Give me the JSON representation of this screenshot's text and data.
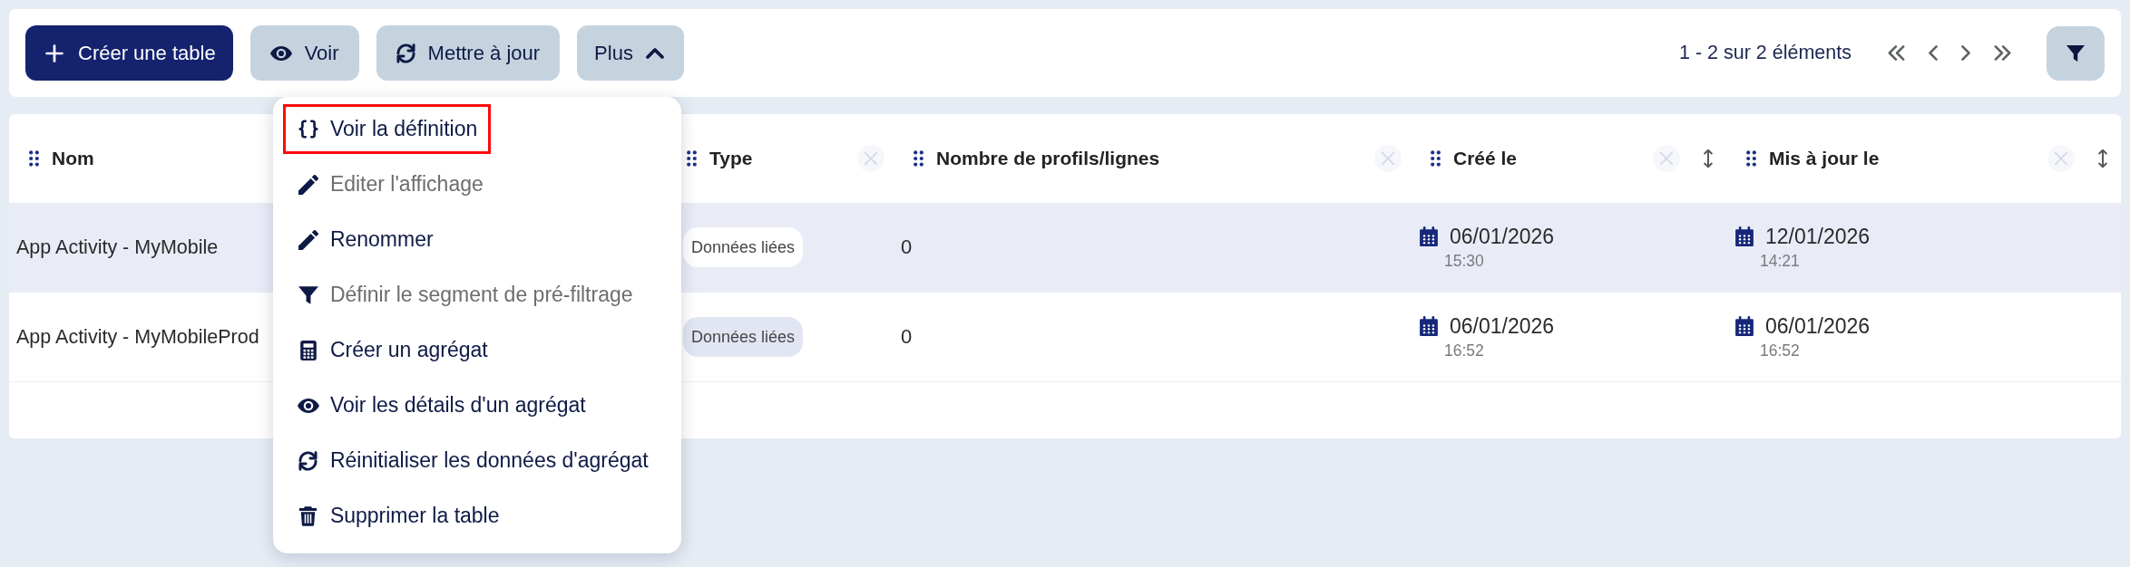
{
  "toolbar": {
    "buttons": [
      {
        "kind": "add",
        "label": "Créer une table"
      },
      {
        "kind": "view",
        "label": "Voir"
      },
      {
        "kind": "refresh",
        "label": "Mettre à jour"
      }
    ],
    "more_button": {
      "label": "Plus",
      "expanded": true
    },
    "pagination": {
      "summary": "1 - 2 sur 2 éléments"
    }
  },
  "menu": {
    "items": [
      {
        "kind": "code",
        "label": "Voir la définition",
        "disabled": false,
        "highlighted": true
      },
      {
        "kind": "edit",
        "label": "Editer l'affichage",
        "disabled": true,
        "highlighted": false
      },
      {
        "kind": "edit",
        "label": "Renommer",
        "disabled": false,
        "highlighted": false
      },
      {
        "kind": "filter",
        "label": "Définir le segment de pré-filtrage",
        "disabled": true,
        "highlighted": false
      },
      {
        "kind": "calculator",
        "label": "Créer un agrégat",
        "disabled": false,
        "highlighted": false
      },
      {
        "kind": "view",
        "label": "Voir les détails d'un agrégat",
        "disabled": false,
        "highlighted": false
      },
      {
        "kind": "reset",
        "label": "Réinitialiser les données d'agrégat",
        "disabled": false,
        "highlighted": false
      },
      {
        "kind": "delete",
        "label": "Supprimer la table",
        "disabled": false,
        "highlighted": false
      }
    ]
  },
  "table": {
    "columns": [
      {
        "label": "Nom",
        "removable": false,
        "sortable": false
      },
      {
        "label": "Type",
        "removable": true,
        "sortable": false
      },
      {
        "label": "Nombre de profils/lignes",
        "removable": true,
        "sortable": false
      },
      {
        "label": "Créé le",
        "removable": true,
        "sortable": true
      },
      {
        "label": "Mis à jour le",
        "removable": true,
        "sortable": true
      }
    ],
    "rows": [
      {
        "selected": true,
        "name": "App Activity - MyMobile",
        "type": "Données liées",
        "count": "0",
        "created": {
          "date": "06/01/2026",
          "time": "15:30"
        },
        "updated": {
          "date": "12/01/2026",
          "time": "14:21"
        }
      },
      {
        "selected": false,
        "name": "App Activity - MyMobileProd",
        "type": "Données liées",
        "count": "0",
        "created": {
          "date": "06/01/2026",
          "time": "16:52"
        },
        "updated": {
          "date": "06/01/2026",
          "time": "16:52"
        }
      }
    ]
  }
}
